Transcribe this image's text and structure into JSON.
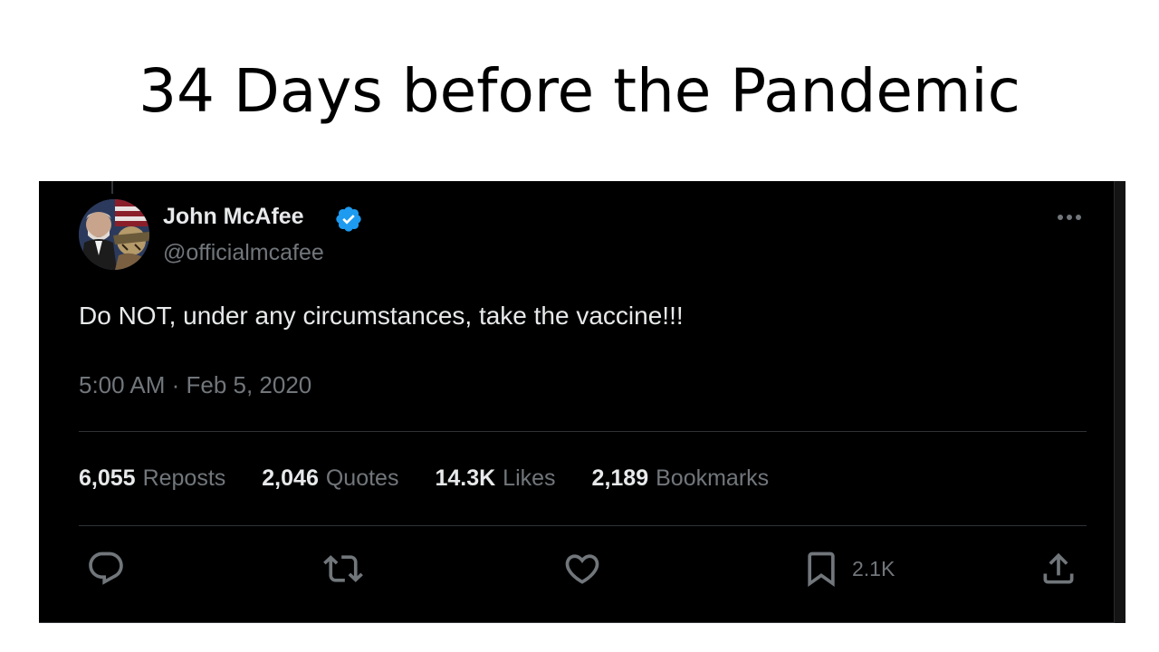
{
  "headline": "34 Days before the Pandemic",
  "tweet": {
    "author_name": "John McAfee",
    "handle": "@officialmcafee",
    "verified": true,
    "text": "Do NOT, under any circumstances, take the vaccine!!!",
    "timestamp": "5:00 AM · Feb 5, 2020",
    "stats": {
      "reposts_count": "6,055",
      "reposts_label": "Reposts",
      "quotes_count": "2,046",
      "quotes_label": "Quotes",
      "likes_count": "14.3K",
      "likes_label": "Likes",
      "bookmarks_count": "2,189",
      "bookmarks_label": "Bookmarks"
    },
    "actions": {
      "reply_icon": "reply-icon",
      "repost_icon": "repost-icon",
      "like_icon": "heart-icon",
      "bookmark_icon": "bookmark-icon",
      "bookmark_count": "2.1K",
      "share_icon": "share-icon"
    }
  },
  "colors": {
    "background": "#000000",
    "text_primary": "#e7e9ea",
    "text_secondary": "#71767b",
    "verified_blue": "#1d9bf0",
    "divider": "#2f3336"
  }
}
